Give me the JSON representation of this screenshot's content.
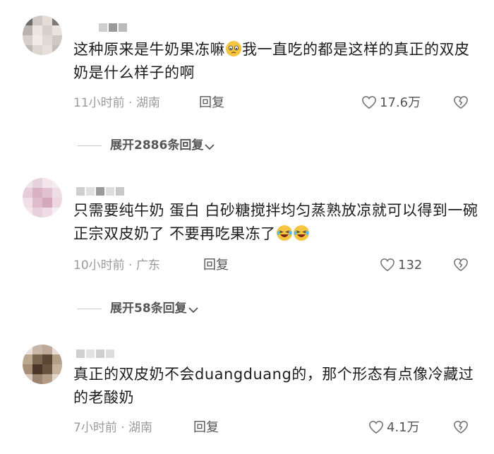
{
  "comments": [
    {
      "text": "这种原来是牛奶果冻嘛",
      "emoji_after_first": "pensive-face",
      "text_cont": "我一直吃的都是这样的真正的双皮奶是什么样子的啊",
      "time": "11小时前",
      "location": "湖南",
      "reply_label": "回复",
      "likes": "17.6万",
      "expand_label": "展开2886条回复"
    },
    {
      "text": "只需要纯牛奶 蛋白 白砂糖搅拌均匀蒸熟放凉就可以得到一碗正宗双皮奶了 不要再吃果冻了",
      "trailing_emojis": [
        "laughing-face",
        "laughing-face"
      ],
      "time": "10小时前",
      "location": "广东",
      "reply_label": "回复",
      "likes": "132",
      "expand_label": "展开58条回复"
    },
    {
      "text": "真正的双皮奶不会duangduang的，那个形态有点像冷藏过的老酸奶",
      "time": "7小时前",
      "location": "湖南",
      "reply_label": "回复",
      "likes": "4.1万"
    }
  ],
  "separator": "·",
  "colors": {
    "meta_gray": "#9a9a9a",
    "text": "#1c1c1c",
    "emoji_yellow": "#f5c542"
  },
  "icons": [
    "heart-outline-icon",
    "broken-heart-icon",
    "chevron-down-icon"
  ]
}
